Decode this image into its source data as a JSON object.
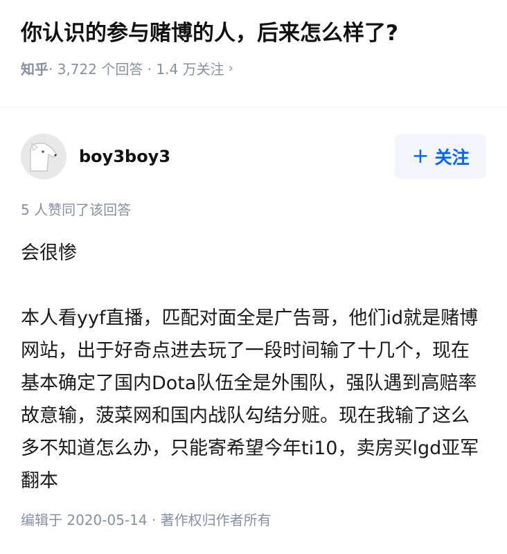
{
  "question": {
    "title": "你认识的参与赌博的人，后来怎么样了?",
    "source": "知乎",
    "stats": "· 3,722 个回答 · 1.4 万关注",
    "chevron": "›"
  },
  "author": {
    "name": "boy3boy3",
    "avatar_icon": "dog-avatar-icon",
    "follow_plus": "+",
    "follow_label": "关注"
  },
  "answer": {
    "vote_text": "5 人赞同了该回答",
    "paragraph_1": "会很惨",
    "paragraph_2": "本人看yyf直播，匹配对面全是广告哥，他们id就是赌博网站，出于好奇点进去玩了一段时间输了十几个，现在基本确定了国内Dota队伍全是外围队，强队遇到高赔率故意输，菠菜网和国内战队勾结分赃。现在我输了这么多不知道怎么办，只能寄希望今年ti10，卖房买lgd亚军翻本",
    "edit_meta": "编辑于 2020-05-14 · 著作权归作者所有"
  },
  "colors": {
    "accent": "#0066ff",
    "meta": "#8590a6",
    "follow_bg": "#f2f5fb"
  }
}
